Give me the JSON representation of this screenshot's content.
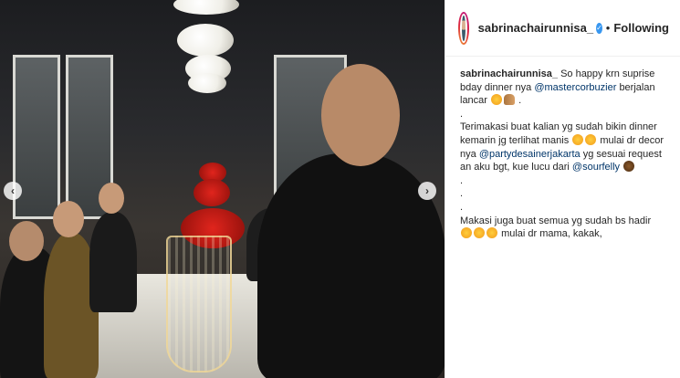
{
  "post": {
    "username": "sabrinachairunnisa_",
    "follow_label": "Following",
    "separator": "•",
    "verified_mark": "✓",
    "nav_prev_glyph": "‹",
    "nav_next_glyph": "›",
    "caption": {
      "line1_text": "So happy krn suprise bday dinner nya",
      "mention1": "@mastercorbuzier",
      "line1_tail": "berjalan lancar",
      "line1_end": ".",
      "dot1": ".",
      "line2": "Terimakasi buat kalian yg sudah bikin dinner kemarin jg terlihat manis",
      "line3_head": "mulai dr decor nya",
      "mention2": "@partydesainerjakarta",
      "line3_tail": "yg sesuai request an aku bgt, kue lucu dari",
      "mention3": "@sourfelly",
      "dot2": ".",
      "dot3": ".",
      "dot4": ".",
      "line4": "Makasi juga buat semua yg sudah bs hadir",
      "line4_tail": "mulai dr mama, kakak,"
    }
  }
}
